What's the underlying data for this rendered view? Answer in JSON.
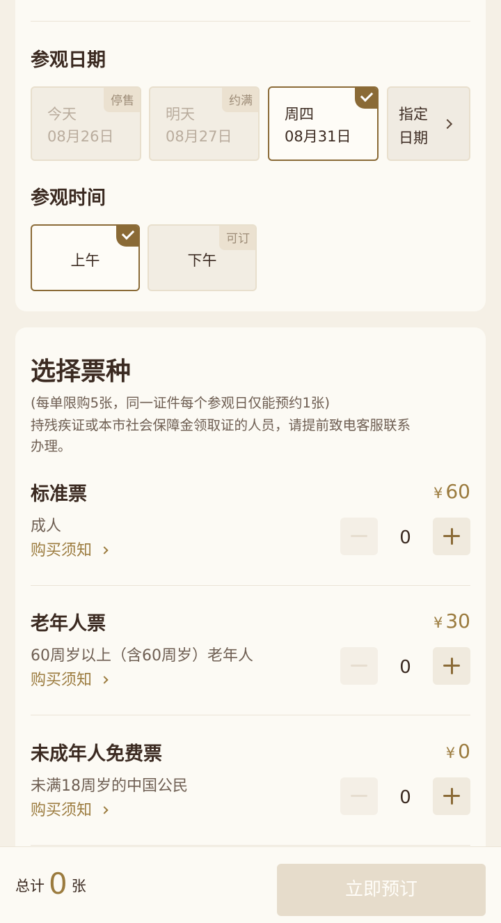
{
  "visit_date": {
    "title": "参观日期",
    "options": [
      {
        "day": "今天",
        "date": "08月26日",
        "tag": "停售"
      },
      {
        "day": "明天",
        "date": "08月27日",
        "tag": "约满"
      },
      {
        "day": "周四",
        "date": "08月31日",
        "tag": ""
      }
    ],
    "pick_date": {
      "line1": "指定",
      "line2": "日期"
    }
  },
  "visit_time": {
    "title": "参观时间",
    "options": [
      {
        "label": "上午",
        "tag": ""
      },
      {
        "label": "下午",
        "tag": "可订"
      }
    ]
  },
  "ticket_section": {
    "title": "选择票种",
    "notice_lines": [
      "(每单限购5张，同一证件每个参观日仅能预约1张)",
      "持残疾证或本市社会保障金领取证的人员，请提前致电客服联系",
      "办理。"
    ],
    "tickets": [
      {
        "name": "标准票",
        "yen": "¥",
        "price": "60",
        "desc": "成人",
        "notice": "购买须知",
        "qty": "0"
      },
      {
        "name": "老年人票",
        "yen": "¥",
        "price": "30",
        "desc": "60周岁以上（含60周岁）老年人",
        "notice": "购买须知",
        "qty": "0"
      },
      {
        "name": "未成年人免费票",
        "yen": "¥",
        "price": "0",
        "desc": "未满18周岁的中国公民",
        "notice": "购买须知",
        "qty": "0"
      }
    ]
  },
  "footer": {
    "total_prefix": "总计",
    "total_count": "0",
    "total_unit": "张",
    "book_label": "立即预订"
  },
  "colors": {
    "accent": "#8a6a36",
    "price": "#9b7b3e",
    "background": "#f5f0e6",
    "card": "#fcfaf4",
    "disabled_button": "#e6dccb"
  }
}
